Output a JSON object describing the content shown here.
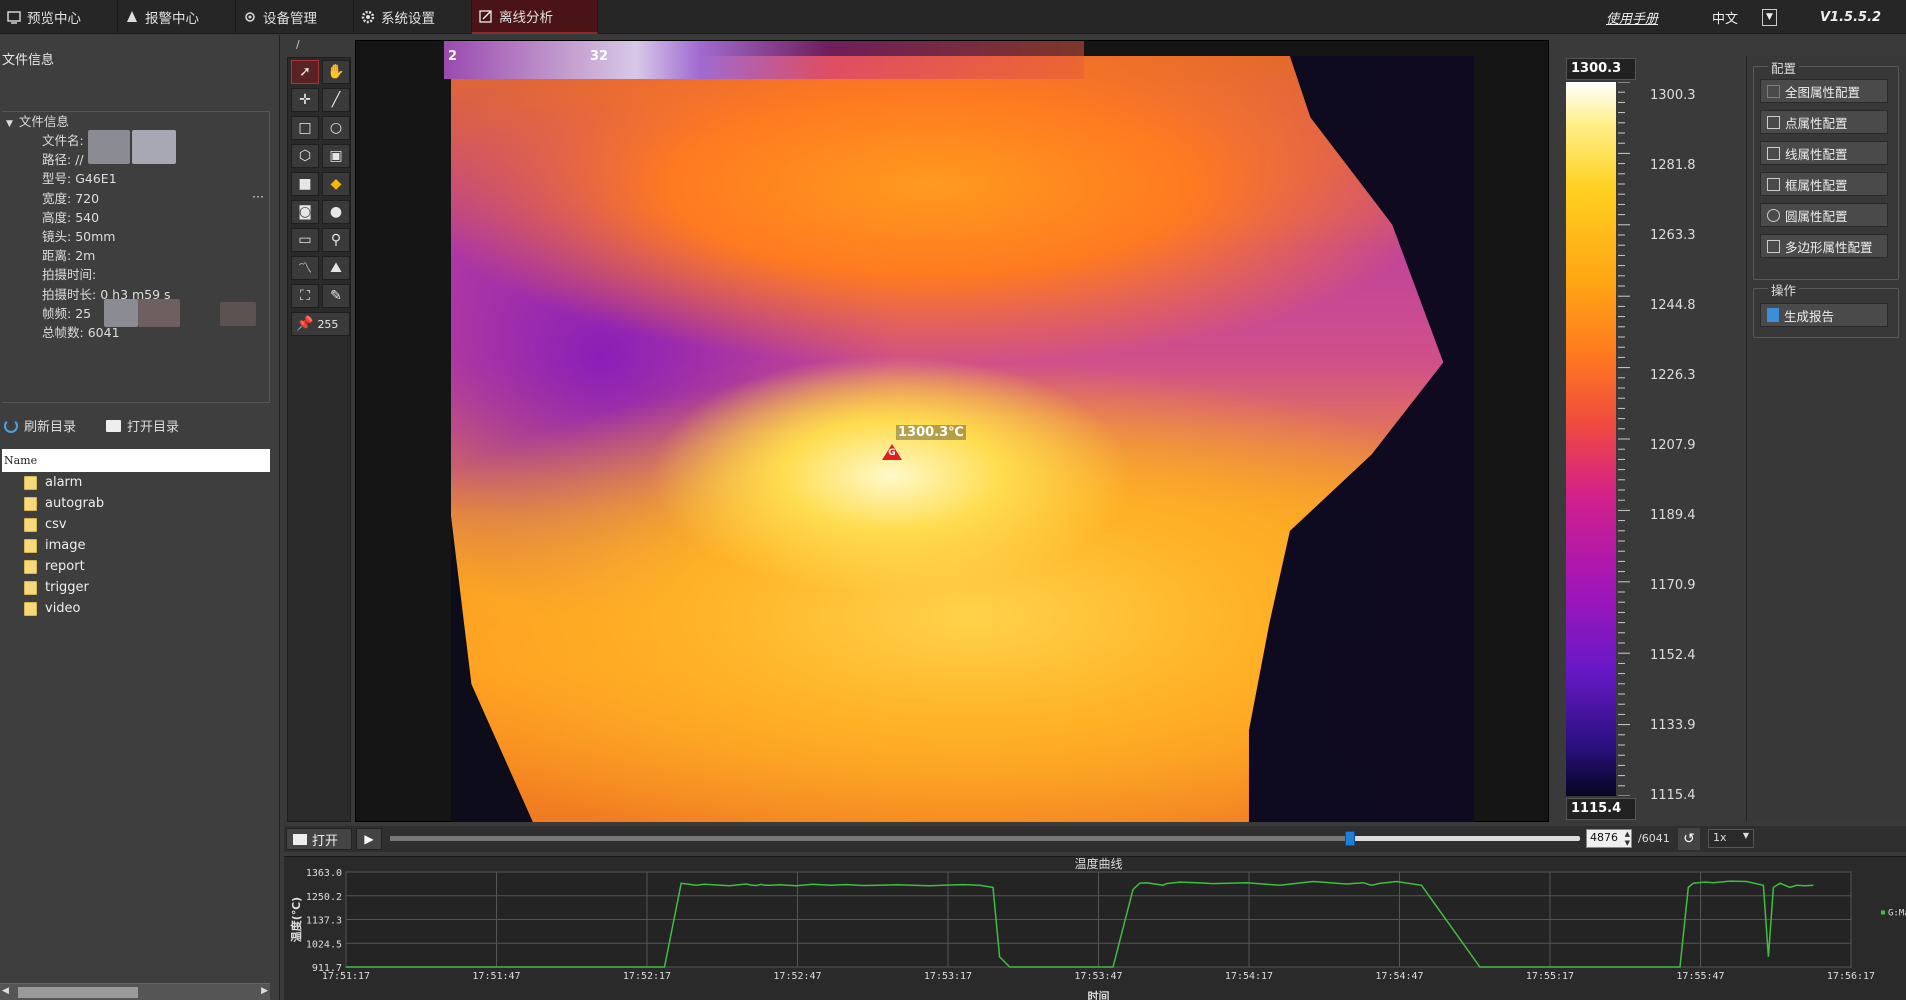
{
  "nav": {
    "tabs": [
      {
        "label": "预览中心",
        "icon": "preview-icon"
      },
      {
        "label": "报警中心",
        "icon": "alarm-icon"
      },
      {
        "label": "设备管理",
        "icon": "device-icon"
      },
      {
        "label": "系统设置",
        "icon": "gear-icon"
      },
      {
        "label": "离线分析",
        "icon": "edit-icon",
        "active": true
      }
    ],
    "manual": "使用手册",
    "language": "中文",
    "version": "V1.5.5.2"
  },
  "file_info": {
    "title": "文件信息",
    "group": "文件信息",
    "rows": [
      {
        "label": "文件名:",
        "value": ""
      },
      {
        "label": "路径:",
        "value": "//"
      },
      {
        "label": "型号:",
        "value": "G46E1"
      },
      {
        "label": "宽度:",
        "value": "720"
      },
      {
        "label": "高度:",
        "value": "540"
      },
      {
        "label": "镜头:",
        "value": "50mm"
      },
      {
        "label": "距离:",
        "value": "2m"
      },
      {
        "label": "拍摄时间:",
        "value": ""
      },
      {
        "label": "拍摄时长:",
        "value": "0 h3 m59 s"
      },
      {
        "label": "帧频:",
        "value": "25"
      },
      {
        "label": "总帧数:",
        "value": "6041"
      }
    ],
    "more": "···"
  },
  "dir": {
    "refresh": "刷新目录",
    "open": "打开目录",
    "header": "Name",
    "folders": [
      "alarm",
      "autograb",
      "csv",
      "image",
      "report",
      "trigger",
      "video"
    ]
  },
  "tools": {
    "marker_count": "255"
  },
  "image": {
    "path_label": "/",
    "spot_label": "1300.3℃",
    "spot_tag": "G",
    "top_partial_left": "2",
    "top_partial_right": "32"
  },
  "colorbar": {
    "max": "1300.3",
    "min": "1115.4",
    "labels": [
      "1300.3",
      "1281.8",
      "1263.3",
      "1244.8",
      "1226.3",
      "1207.9",
      "1189.4",
      "1170.9",
      "1152.4",
      "1133.9",
      "1115.4"
    ]
  },
  "config": {
    "group_title": "配置",
    "buttons": [
      "全图属性配置",
      "点属性配置",
      "线属性配置",
      "框属性配置",
      "圆属性配置",
      "多边形属性配置"
    ],
    "ops_title": "操作",
    "report": "生成报告"
  },
  "playback": {
    "open": "打开",
    "frame": "4876",
    "total": "/6041",
    "progress": 0.807,
    "speed": "1x"
  },
  "chart_data": {
    "type": "line",
    "title": "温度曲线",
    "ylabel": "温度(℃)",
    "xlabel": "时间",
    "ylim": [
      911.7,
      1363.0
    ],
    "yticks": [
      "1363.0",
      "1250.2",
      "1137.3",
      "1024.5",
      "911.7"
    ],
    "xticks": [
      "17:51:17",
      "17:51:47",
      "17:52:17",
      "17:52:47",
      "17:53:17",
      "17:53:47",
      "17:54:17",
      "17:54:47",
      "17:55:17",
      "17:55:47",
      "17:56:17"
    ],
    "grid": true,
    "legend_position": "right",
    "series": [
      {
        "name": "G:Max",
        "color": "#3fbf3f",
        "x": [
          0,
          180,
          185,
          188,
          191,
          201,
          210,
          215,
          220,
          230,
          240,
          243,
          246,
          249,
          251,
          255,
          260,
          270,
          280,
          290,
          300,
          310,
          320,
          330,
          340,
          350,
          360,
          370,
          380,
          388,
          392,
          398,
          420,
          440,
          460,
          472,
          476,
          480,
          486,
          490,
          492,
          500,
          510,
          520,
          540,
          560,
          580,
          600,
          610,
          615,
          620,
          630,
          645,
          680,
          700,
          720,
          750,
          780,
          800,
          805,
          808,
          815,
          820,
          830,
          840,
          850,
          853,
          856,
          860,
          866,
          870,
          875,
          880
        ],
        "y": [
          911.7,
          911.7,
          911.7,
          911.7,
          911.7,
          1310,
          1300,
          1305,
          1302,
          1298,
          1306,
          1301,
          1299,
          1304,
          1300,
          1300,
          1302,
          1298,
          1305,
          1300,
          1303,
          1299,
          1300,
          1302,
          1300,
          1298,
          1301,
          1303,
          1300,
          1290,
          960,
          911.7,
          911.7,
          911.7,
          911.7,
          1280,
          1310,
          1312,
          1305,
          1300,
          1308,
          1315,
          1312,
          1308,
          1312,
          1300,
          1318,
          1306,
          1312,
          1300,
          1309,
          1318,
          1300,
          911.7,
          911.7,
          911.7,
          911.7,
          911.7,
          911.7,
          1290,
          1310,
          1315,
          1312,
          1320,
          1318,
          1300,
          960,
          1290,
          1310,
          1290,
          1300,
          1298,
          1300
        ]
      }
    ],
    "x_span_seconds": 300
  }
}
